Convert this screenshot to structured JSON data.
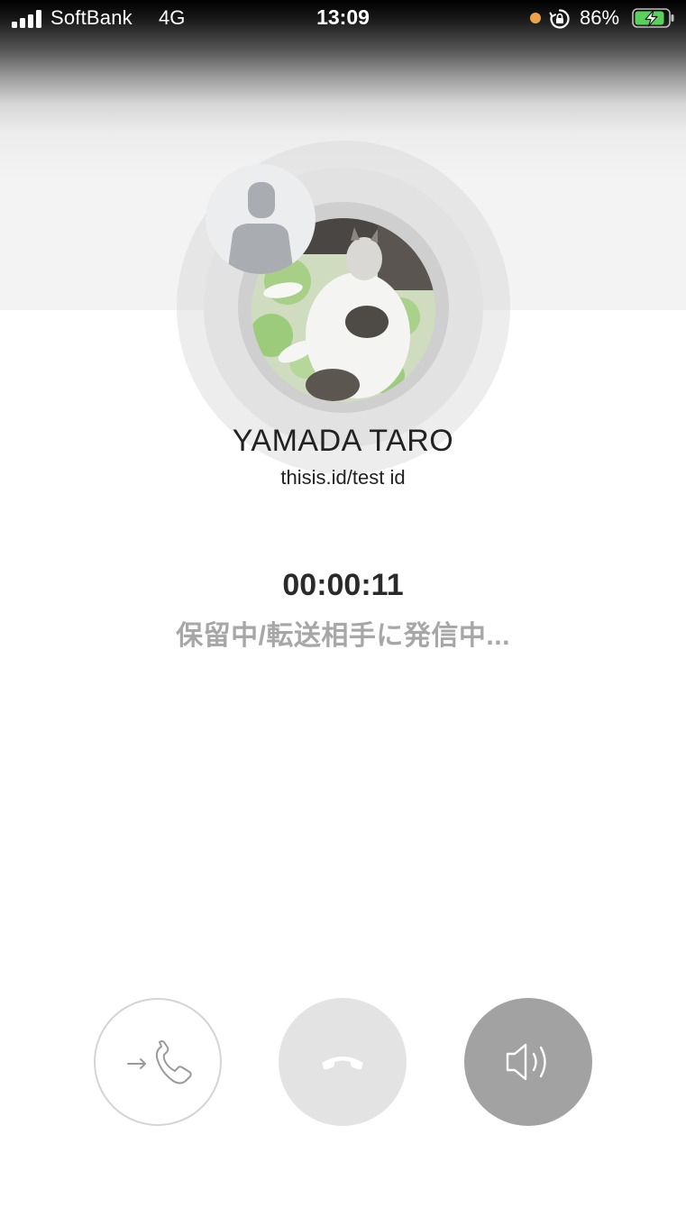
{
  "status_bar": {
    "carrier": "SoftBank",
    "network": "4G",
    "time": "13:09",
    "battery_percent": "86%",
    "icons": [
      "signal-bars-icon",
      "mic-in-use-dot-icon",
      "rotation-lock-icon",
      "battery-charging-icon"
    ],
    "colors": {
      "mic_dot": "#f0a24a",
      "battery_fill": "#5ad15a"
    }
  },
  "caller": {
    "name": "YAMADA TARO",
    "id": "thisis.id/test id"
  },
  "call": {
    "duration": "00:00:11",
    "status": "保留中/転送相手に発信中..."
  },
  "controls": {
    "icons": [
      "transfer-call-icon",
      "end-call-icon",
      "speaker-icon"
    ]
  }
}
